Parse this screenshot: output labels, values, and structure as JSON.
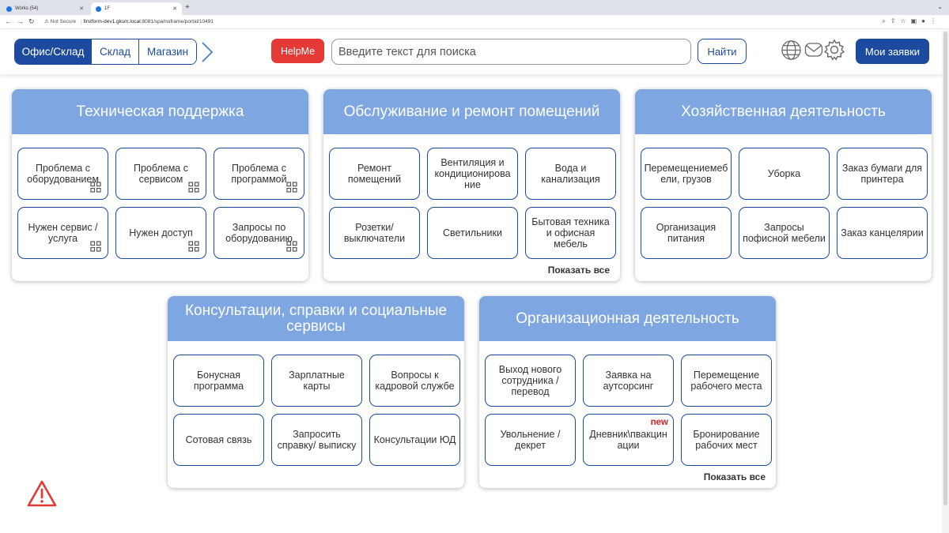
{
  "browser": {
    "tabs": [
      {
        "title": "Works (54)"
      },
      {
        "title": "1F"
      }
    ],
    "new_tab": "+",
    "security_label": "Not Secure",
    "url_host": "firstform-dev1.gksm.local",
    "url_path": ":8081/spa/noframe/portal/10491"
  },
  "header": {
    "segments": [
      "Офис/Склад",
      "Склад",
      "Магазин"
    ],
    "active_segment": "Офис/Склад",
    "helpme_label": "HelpMe",
    "search_placeholder": "Введите текст для поиска",
    "find_label": "Найти",
    "my_requests_label": "Мои заявки",
    "icons": [
      "globe-icon",
      "mail-icon",
      "settings-gear-icon"
    ]
  },
  "colors": {
    "primary": "#1b4a9f",
    "card_header": "#7ea7e1",
    "helpme": "#e53935",
    "new_badge": "#e02020"
  },
  "cards": [
    {
      "title": "Техническая поддержка",
      "tiles": [
        {
          "label": "Проблема с оборудованием",
          "has_grid_icon": true
        },
        {
          "label": "Проблема с сервисом",
          "has_grid_icon": true
        },
        {
          "label": "Проблема с программой",
          "has_grid_icon": true
        },
        {
          "label": "Нужен сервис / услуга",
          "has_grid_icon": true
        },
        {
          "label": "Нужен доступ",
          "has_grid_icon": true
        },
        {
          "label": "Запросы по оборудованию",
          "has_grid_icon": true
        }
      ],
      "show_all": ""
    },
    {
      "title": "Обслуживание и ремонт помещений",
      "tiles": [
        {
          "label": "Ремонт помещений"
        },
        {
          "label": "Вентиляция и кондиционирова ние"
        },
        {
          "label": "Вода и канализация"
        },
        {
          "label": "Розетки/ выключатели"
        },
        {
          "label": "Светильники"
        },
        {
          "label": "Бытовая техника и офисная мебель"
        }
      ],
      "show_all": "Показать все"
    },
    {
      "title": "Хозяйственная деятельность",
      "tiles": [
        {
          "label": "Перемещениемеб ели, грузов"
        },
        {
          "label": "Уборка"
        },
        {
          "label": "Заказ бумаги для принтера"
        },
        {
          "label": "Организация питания"
        },
        {
          "label": "Запросы пофисной мебели"
        },
        {
          "label": "Заказ канцелярии"
        }
      ],
      "show_all": ""
    },
    {
      "title": "Консультации, справки и социальные сервисы",
      "tiles": [
        {
          "label": "Бонусная программа"
        },
        {
          "label": "Зарплатные карты"
        },
        {
          "label": "Вопросы к кадровой службе"
        },
        {
          "label": "Сотовая связь"
        },
        {
          "label": "Запросить справку/ выписку"
        },
        {
          "label": "Консультации ЮД"
        }
      ],
      "show_all": ""
    },
    {
      "title": "Организационная деятельность",
      "tiles": [
        {
          "label": "Выход нового сотрудника / перевод"
        },
        {
          "label": "Заявка на аутсорсинг"
        },
        {
          "label": "Перемещение рабочего места"
        },
        {
          "label": "Увольнение / декрет"
        },
        {
          "label": "Дневник\\пвакцин ации",
          "badge": "new"
        },
        {
          "label": "Бронирование рабочих мест"
        }
      ],
      "show_all": "Показать все"
    }
  ],
  "warning_icon": "warning-triangle-icon"
}
